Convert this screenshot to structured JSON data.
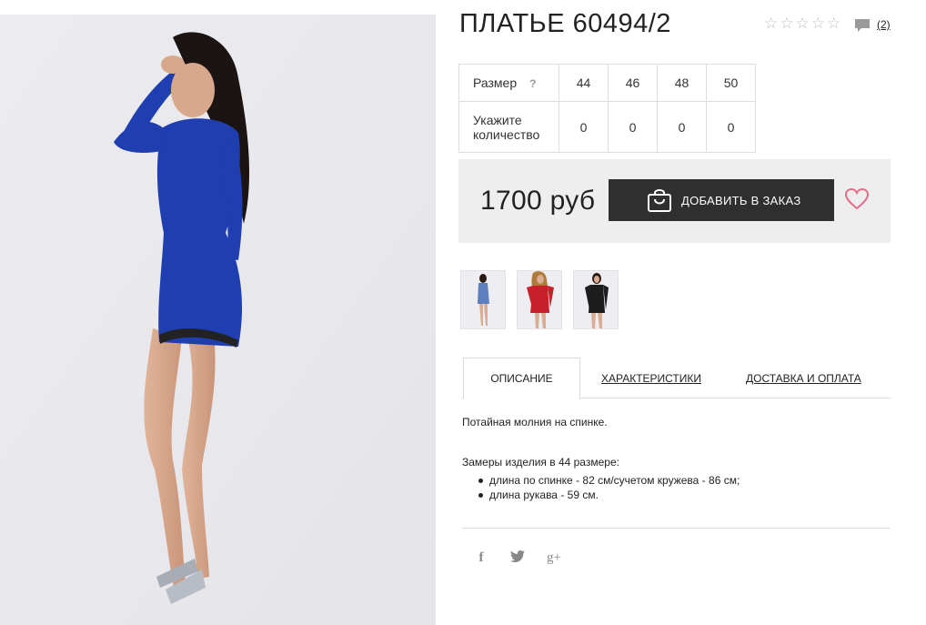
{
  "product": {
    "title": "ПЛАТЬЕ 60494/2",
    "rating_stars": 5,
    "rating_value": 0,
    "reviews_count": "(2)",
    "price": "1700 руб",
    "add_button_label": "ДОБАВИТЬ В ЗАКАЗ"
  },
  "sizes": {
    "size_label": "Размер",
    "help": "?",
    "quantity_label_1": "Укажите",
    "quantity_label_2": "количество",
    "values": [
      "44",
      "46",
      "48",
      "50"
    ],
    "quantities": [
      "0",
      "0",
      "0",
      "0"
    ]
  },
  "thumbnails": [
    {
      "name": "blue",
      "color": "#5b7fbf"
    },
    {
      "name": "red",
      "color": "#c8202a"
    },
    {
      "name": "black",
      "color": "#1d1d1d"
    }
  ],
  "tabs": {
    "description": "ОПИСАНИЕ",
    "characteristics": "ХАРАКТЕРИСТИКИ",
    "delivery": "ДОСТАВКА И ОПЛАТА"
  },
  "description": {
    "text": "Потайная молния на спинке.",
    "measure_title": "Замеры изделия в 44 размере:",
    "measures": [
      "длина по спинке - 82 см/сучетом кружева - 86 см;",
      "длина рукава - 59 см."
    ]
  },
  "share": {
    "facebook": "f",
    "twitter": "twitter-icon",
    "googleplus": "g+"
  },
  "colors": {
    "dress": "#1f3fb0",
    "button_bg": "#2f2f2f",
    "heart": "#e0708a",
    "buybox_bg": "#eeeeee"
  }
}
